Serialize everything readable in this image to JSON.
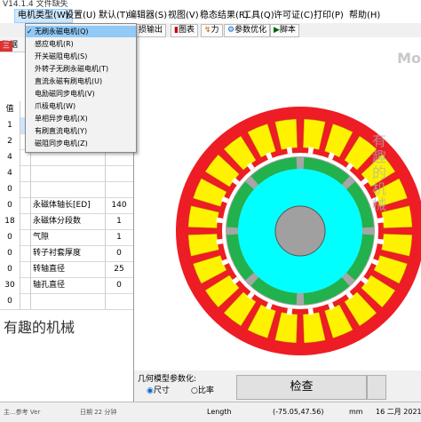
{
  "title": "V14.1.4 文件缺失",
  "menu": [
    "电机类型(W)",
    "设置(U)",
    "默认(T)",
    "编辑器(S)",
    "视图(V)",
    "稳态结果(R)",
    "工具(Q)",
    "许可证(C)",
    "打印(P)",
    "帮助(H)"
  ],
  "toolbar": [
    "损输出",
    "图表",
    "力",
    "参数优化",
    "脚本"
  ],
  "left_tabs": {
    "t1": "数据",
    "t2": "三"
  },
  "dropdown_items": [
    {
      "label": "无刷永磁电机(Q)",
      "checked": true
    },
    {
      "label": "感应电机(R)"
    },
    {
      "label": "开关磁阻电机(S)"
    },
    {
      "label": "外转子无刷永磁电机(T)"
    },
    {
      "label": "直流永磁有刷电机(U)"
    },
    {
      "label": "电励磁同步电机(V)"
    },
    {
      "label": "爪极电机(W)"
    },
    {
      "label": "单相异步电机(X)"
    },
    {
      "label": "有刷直流电机(Y)"
    },
    {
      "label": "磁阻同步电机(Z)"
    }
  ],
  "grid_rows": [
    {
      "num": "值",
      "label": "",
      "value": ""
    },
    {
      "num": "1",
      "label": "",
      "value": ""
    },
    {
      "num": "2",
      "label": "",
      "value": ""
    },
    {
      "num": "4",
      "label": "",
      "value": ""
    },
    {
      "num": "4",
      "label": "",
      "value": ""
    },
    {
      "num": "0",
      "label": "",
      "value": ""
    },
    {
      "num": "0",
      "label": "永磁体轴长[ED]",
      "value": "140"
    },
    {
      "num": "18",
      "label": "永磁体分段数",
      "value": "1"
    },
    {
      "num": "0",
      "label": "气隙",
      "value": "1"
    },
    {
      "num": "0",
      "label": "转子衬套厚度",
      "value": "0"
    },
    {
      "num": "0",
      "label": "转轴直径",
      "value": "25"
    },
    {
      "num": "30",
      "label": "轴孔直径",
      "value": "0"
    },
    {
      "num": "0",
      "label": "",
      "value": ""
    }
  ],
  "watermark": "有趣的机械",
  "canvas_corner": "Mo",
  "canvas_watermark_v": "有趣的机械",
  "geometry_label": "几何模型参数化:",
  "radio_size": "尺寸",
  "radio_ratio": "比率",
  "check_button": "检查",
  "status": {
    "length_label": "Length",
    "coords": "(-75.05,47.56)",
    "unit": "mm",
    "date": "16 二月 2021",
    "left_text": "主...参考 Ver",
    "mid_text": "日期 22 分钟"
  },
  "colors": {
    "stator_red": "#ee1c24",
    "winding_yellow": "#fff200",
    "air_white": "#ffffff",
    "rotor_gray": "#a6a6a6",
    "magnet_green": "#22b14c",
    "rotor_cyan": "#00ffff",
    "shaft_gray": "#a0a0a0"
  }
}
